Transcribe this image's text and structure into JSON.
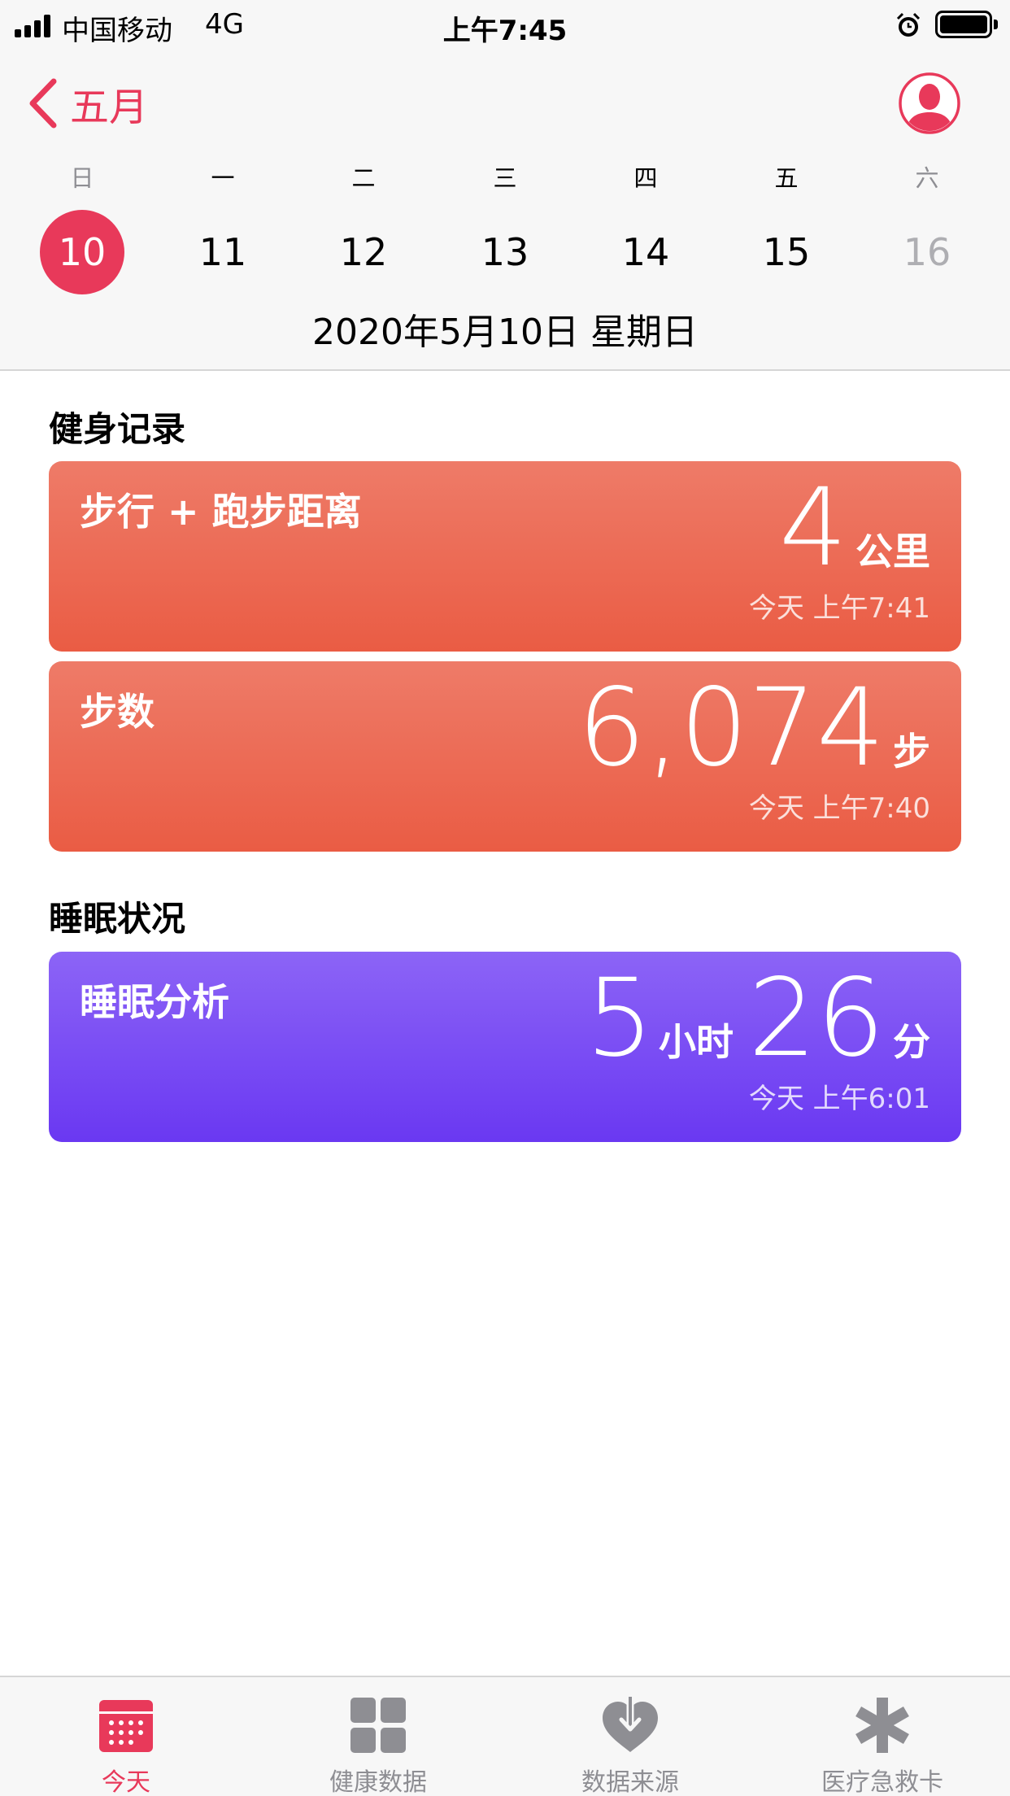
{
  "status_bar": {
    "carrier": "中国移动",
    "network": "4G",
    "time": "上午7:45"
  },
  "nav": {
    "back_label": "五月"
  },
  "week": {
    "days": [
      {
        "weekday": "日",
        "date": "10",
        "state": "selected"
      },
      {
        "weekday": "一",
        "date": "11",
        "state": "normal"
      },
      {
        "weekday": "二",
        "date": "12",
        "state": "normal"
      },
      {
        "weekday": "三",
        "date": "13",
        "state": "normal"
      },
      {
        "weekday": "四",
        "date": "14",
        "state": "normal"
      },
      {
        "weekday": "五",
        "date": "15",
        "state": "normal"
      },
      {
        "weekday": "六",
        "date": "16",
        "state": "future"
      }
    ],
    "full_date": "2020年5月10日 星期日"
  },
  "fitness": {
    "section_title": "健身记录",
    "distance": {
      "title": "步行 + 跑步距离",
      "value": "4",
      "unit": "公里",
      "time": "今天 上午7:41"
    },
    "steps": {
      "title": "步数",
      "value": "6,074",
      "unit": "步",
      "time": "今天 上午7:40"
    }
  },
  "sleep": {
    "section_title": "睡眠状况",
    "analysis": {
      "title": "睡眠分析",
      "hours": "5",
      "hours_unit": "小时",
      "minutes": "26",
      "minutes_unit": "分",
      "time": "今天 上午6:01"
    }
  },
  "tabs": [
    {
      "label": "今天",
      "icon": "calendar-icon",
      "active": true
    },
    {
      "label": "健康数据",
      "icon": "grid-icon",
      "active": false
    },
    {
      "label": "数据来源",
      "icon": "heart-download-icon",
      "active": false
    },
    {
      "label": "医疗急救卡",
      "icon": "asterisk-icon",
      "active": false
    }
  ],
  "colors": {
    "accent": "#e8395a",
    "fitness_card_top": "#ee7b68",
    "fitness_card_bottom": "#ea5c44",
    "sleep_card_top": "#8c64f6",
    "sleep_card_bottom": "#6a38f2",
    "inactive_tab": "#8e8e93"
  }
}
